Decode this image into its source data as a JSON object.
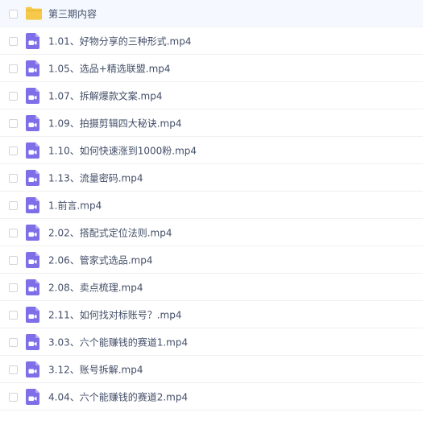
{
  "folder": {
    "name": "第三期内容",
    "icon": "folder-icon",
    "color": "#f7c94a"
  },
  "video_icon_color": "#7e6fe8",
  "files": [
    {
      "name": "1.01、好物分享的三种形式.mp4"
    },
    {
      "name": "1.05、选品+精选联盟.mp4"
    },
    {
      "name": "1.07、拆解爆款文案.mp4"
    },
    {
      "name": "1.09、拍摄剪辑四大秘诀.mp4"
    },
    {
      "name": "1.10、如何快速涨到1000粉.mp4"
    },
    {
      "name": "1.13、流量密码.mp4"
    },
    {
      "name": "1.前言.mp4"
    },
    {
      "name": "2.02、搭配式定位法则.mp4"
    },
    {
      "name": "2.06、管家式选品.mp4"
    },
    {
      "name": "2.08、卖点梳理.mp4"
    },
    {
      "name": "2.11、如何找对标账号？.mp4"
    },
    {
      "name": "3.03、六个能赚钱的赛道1.mp4"
    },
    {
      "name": "3.12、账号拆解.mp4"
    },
    {
      "name": "4.04、六个能赚钱的赛道2.mp4"
    }
  ]
}
